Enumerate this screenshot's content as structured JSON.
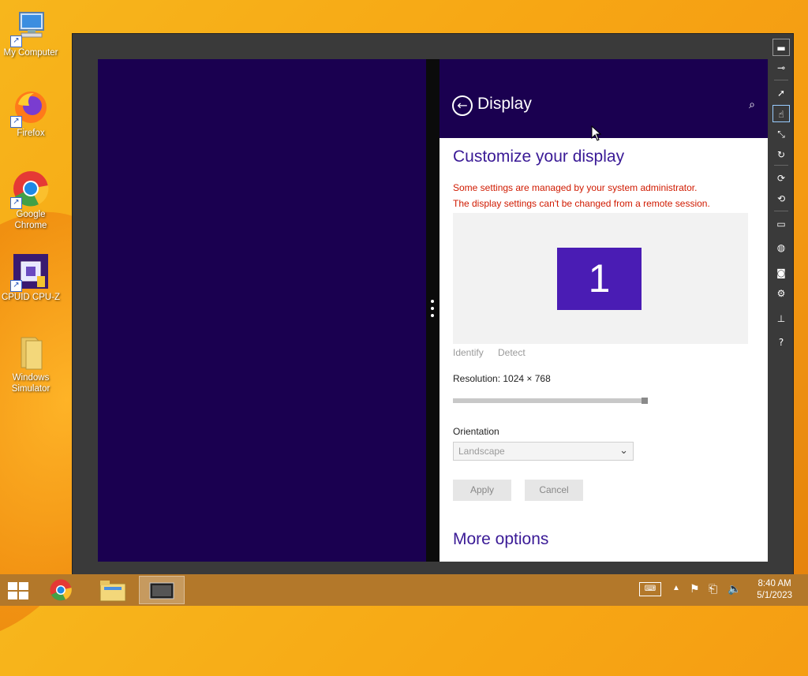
{
  "desktop": {
    "icons": [
      {
        "label": "My Computer"
      },
      {
        "label": "Firefox"
      },
      {
        "label": "Google Chrome"
      },
      {
        "label": "CPUID CPU-Z"
      },
      {
        "label": "Windows Simulator"
      }
    ]
  },
  "settings": {
    "header_title": "Display",
    "heading": "Customize your display",
    "warnings": [
      "Some settings are managed by your system administrator.",
      "The display settings can't be changed from a remote session."
    ],
    "monitor_number": "1",
    "identify_label": "Identify",
    "detect_label": "Detect",
    "resolution_label": "Resolution: 1024 × 768",
    "orientation_label": "Orientation",
    "orientation_value": "Landscape",
    "apply_label": "Apply",
    "cancel_label": "Cancel",
    "more_options": "More options"
  },
  "taskbar": {
    "time": "8:40 AM",
    "date": "5/1/2023"
  },
  "colors": {
    "accent": "#1a0050",
    "heading": "#3a1a96",
    "warning": "#d01a00",
    "monitor_tile": "#4a1cb4"
  }
}
